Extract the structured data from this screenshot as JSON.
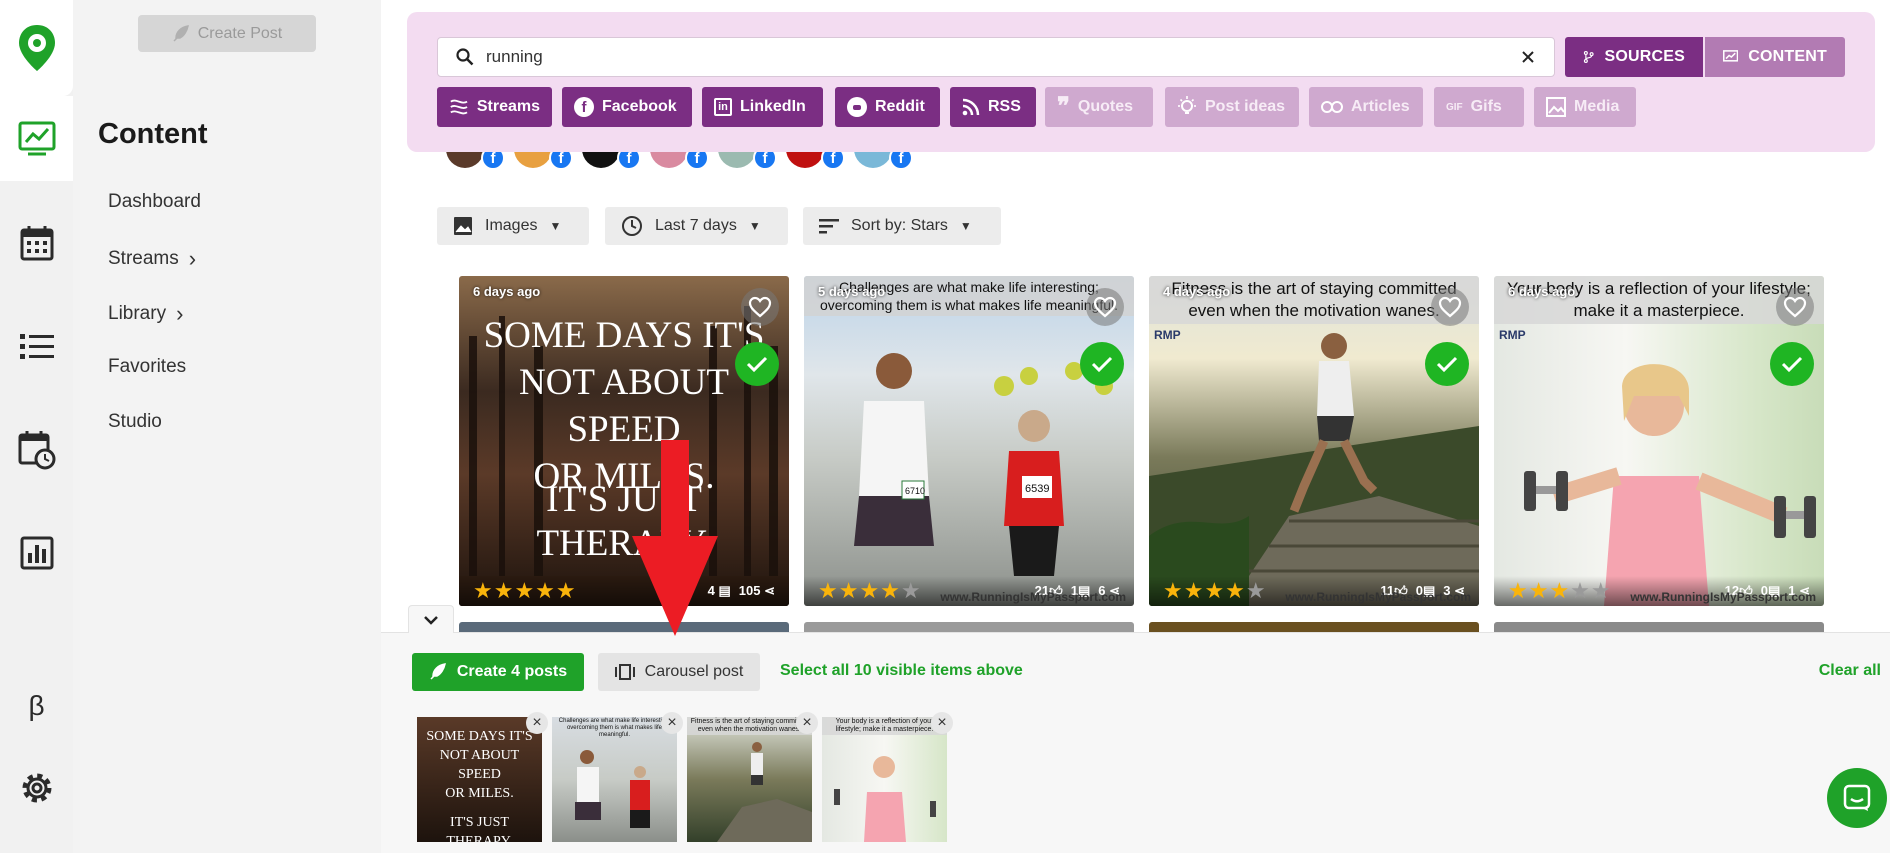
{
  "sidebar": {
    "create_post_label": "Create Post",
    "title": "Content",
    "items": [
      {
        "label": "Dashboard",
        "has_chevron": false
      },
      {
        "label": "Streams",
        "has_chevron": true
      },
      {
        "label": "Library",
        "has_chevron": true
      },
      {
        "label": "Favorites",
        "has_chevron": false
      },
      {
        "label": "Studio",
        "has_chevron": false
      }
    ]
  },
  "rail": {
    "icons": [
      "logo-pin-icon",
      "content-chart-icon",
      "calendar-icon",
      "list-icon",
      "schedule-icon",
      "analytics-icon",
      "beta-icon",
      "gear-icon"
    ],
    "beta_label": "β"
  },
  "search": {
    "value": "running",
    "modes": {
      "sources": "SOURCES",
      "content": "CONTENT"
    },
    "sources": [
      {
        "label": "Streams",
        "active": true
      },
      {
        "label": "Facebook",
        "active": true
      },
      {
        "label": "LinkedIn",
        "active": true
      },
      {
        "label": "Reddit",
        "active": true
      },
      {
        "label": "RSS",
        "active": true
      },
      {
        "label": "Quotes",
        "active": false
      },
      {
        "label": "Post ideas",
        "active": false
      },
      {
        "label": "Articles",
        "active": false
      },
      {
        "label": "Gifs",
        "active": false
      },
      {
        "label": "Media",
        "active": false
      }
    ],
    "gif_icon_text": "GIF"
  },
  "filters": {
    "type": "Images",
    "range": "Last 7 days",
    "sort": "Sort by: Stars"
  },
  "cards": [
    {
      "ago": "6 days ago",
      "stars": 5,
      "stats": {
        "comments": "4",
        "shares": "105"
      },
      "quote_lines": [
        "SOME DAYS IT'S",
        "NOT ABOUT SPEED",
        "OR MILES."
      ],
      "quote_lines_2": [
        "IT'S JUST",
        "THERAPY."
      ]
    },
    {
      "ago": "5 days ago",
      "stars": 4,
      "caption": "Challenges are what make life interesting; overcoming them is what makes life meaningful.",
      "stats": {
        "likes": "21",
        "comments": "1",
        "shares": "6"
      },
      "watermark": "www.RunningIsMyPassport.com",
      "bib": "6539",
      "bib2": "6710"
    },
    {
      "ago": "4 days ago",
      "stars": 4,
      "caption": "Fitness is the art of staying committed even when the motivation wanes.",
      "stats": {
        "likes": "11",
        "comments": "0",
        "shares": "3"
      },
      "watermark": "www.RunningIsMyPassport.com",
      "brand": "RMP"
    },
    {
      "ago": "6 days ago",
      "stars": 3,
      "caption": "Your body is a reflection of your lifestyle; make it a masterpiece.",
      "stats": {
        "likes": "12",
        "comments": "0",
        "shares": "1"
      },
      "watermark": "www.RunningIsMyPassport.com",
      "brand": "RMP"
    }
  ],
  "tray": {
    "create_label": "Create 4 posts",
    "carousel_label": "Carousel post",
    "select_all": "Select all 10 visible items above",
    "clear_all": "Clear all"
  },
  "colors": {
    "brand_green": "#1fa229",
    "purple": "#7b2e83",
    "panel_pink": "#f3dcf1",
    "check_green": "#1fb523"
  }
}
